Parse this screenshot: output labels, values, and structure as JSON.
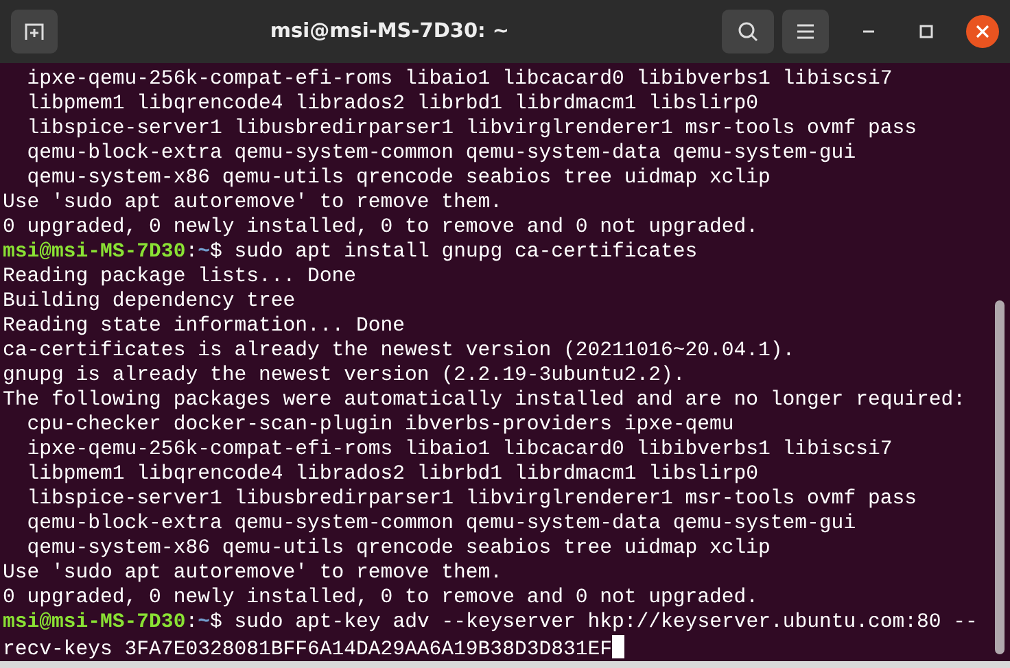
{
  "window": {
    "title": "msi@msi-MS-7D30: ~"
  },
  "terminal": {
    "lines": [
      {
        "kind": "output",
        "text": "  ipxe-qemu-256k-compat-efi-roms libaio1 libcacard0 libibverbs1 libiscsi7"
      },
      {
        "kind": "output",
        "text": "  libpmem1 libqrencode4 librados2 librbd1 librdmacm1 libslirp0"
      },
      {
        "kind": "output",
        "text": "  libspice-server1 libusbredirparser1 libvirglrenderer1 msr-tools ovmf pass"
      },
      {
        "kind": "output",
        "text": "  qemu-block-extra qemu-system-common qemu-system-data qemu-system-gui"
      },
      {
        "kind": "output",
        "text": "  qemu-system-x86 qemu-utils qrencode seabios tree uidmap xclip"
      },
      {
        "kind": "output",
        "text": "Use 'sudo apt autoremove' to remove them."
      },
      {
        "kind": "output",
        "text": "0 upgraded, 0 newly installed, 0 to remove and 0 not upgraded."
      },
      {
        "kind": "prompt",
        "user": "msi@msi-MS-7D30",
        "separator": ":",
        "path": "~",
        "symbol": "$",
        "command": "sudo apt install gnupg ca-certificates"
      },
      {
        "kind": "output",
        "text": "Reading package lists... Done"
      },
      {
        "kind": "output",
        "text": "Building dependency tree"
      },
      {
        "kind": "output",
        "text": "Reading state information... Done"
      },
      {
        "kind": "output",
        "text": "ca-certificates is already the newest version (20211016~20.04.1)."
      },
      {
        "kind": "output",
        "text": "gnupg is already the newest version (2.2.19-3ubuntu2.2)."
      },
      {
        "kind": "output",
        "text": "The following packages were automatically installed and are no longer required:"
      },
      {
        "kind": "output",
        "text": "  cpu-checker docker-scan-plugin ibverbs-providers ipxe-qemu"
      },
      {
        "kind": "output",
        "text": "  ipxe-qemu-256k-compat-efi-roms libaio1 libcacard0 libibverbs1 libiscsi7"
      },
      {
        "kind": "output",
        "text": "  libpmem1 libqrencode4 librados2 librbd1 librdmacm1 libslirp0"
      },
      {
        "kind": "output",
        "text": "  libspice-server1 libusbredirparser1 libvirglrenderer1 msr-tools ovmf pass"
      },
      {
        "kind": "output",
        "text": "  qemu-block-extra qemu-system-common qemu-system-data qemu-system-gui"
      },
      {
        "kind": "output",
        "text": "  qemu-system-x86 qemu-utils qrencode seabios tree uidmap xclip"
      },
      {
        "kind": "output",
        "text": "Use 'sudo apt autoremove' to remove them."
      },
      {
        "kind": "output",
        "text": "0 upgraded, 0 newly installed, 0 to remove and 0 not upgraded."
      },
      {
        "kind": "prompt",
        "user": "msi@msi-MS-7D30",
        "separator": ":",
        "path": "~",
        "symbol": "$",
        "command": "sudo apt-key adv --keyserver hkp://keyserver.ubuntu.com:80 --"
      },
      {
        "kind": "output",
        "text": "recv-keys 3FA7E0328081BFF6A14DA29AA6A19B38D3D831EF",
        "cursor": true
      }
    ]
  }
}
